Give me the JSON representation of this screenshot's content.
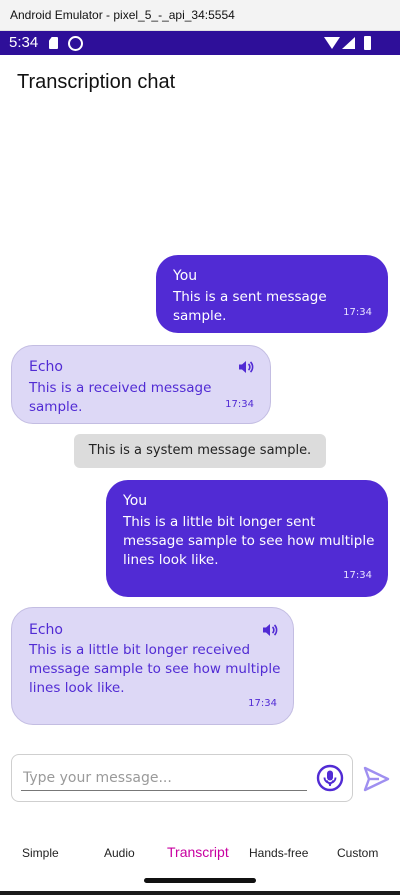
{
  "window": {
    "title": "Android Emulator - pixel_5_-_api_34:5554"
  },
  "status_bar": {
    "time": "5:34"
  },
  "header": {
    "title": "Transcription chat"
  },
  "messages": [
    {
      "type": "sent",
      "sender": "You",
      "text": "This is a sent message sample.",
      "time": "17:34"
    },
    {
      "type": "received",
      "sender": "Echo",
      "text": "This is a received message sample.",
      "time": "17:34",
      "icon": "speaker-icon"
    },
    {
      "type": "system",
      "text": "This is a system message sample."
    },
    {
      "type": "sent",
      "sender": "You",
      "text": "This is a little bit longer sent message sample to see how multiple lines look like.",
      "time": "17:34"
    },
    {
      "type": "received",
      "sender": "Echo",
      "text": "This is a little bit longer received message sample to see how multiple lines look like.",
      "time": "17:34",
      "icon": "speaker-icon"
    }
  ],
  "composer": {
    "placeholder": "Type your message...",
    "mic_icon": "microphone-icon",
    "send_icon": "send-icon"
  },
  "tabs": [
    {
      "label": "Simple"
    },
    {
      "label": "Audio"
    },
    {
      "label": "Transcript",
      "active": true
    },
    {
      "label": "Hands-free"
    },
    {
      "label": "Custom"
    }
  ],
  "colors": {
    "accent": "#512bd4",
    "received_bg": "#ddd8f6",
    "status_bar": "#2e0f99",
    "active_tab": "#c800a0",
    "system_bg": "#dcdcdc"
  }
}
